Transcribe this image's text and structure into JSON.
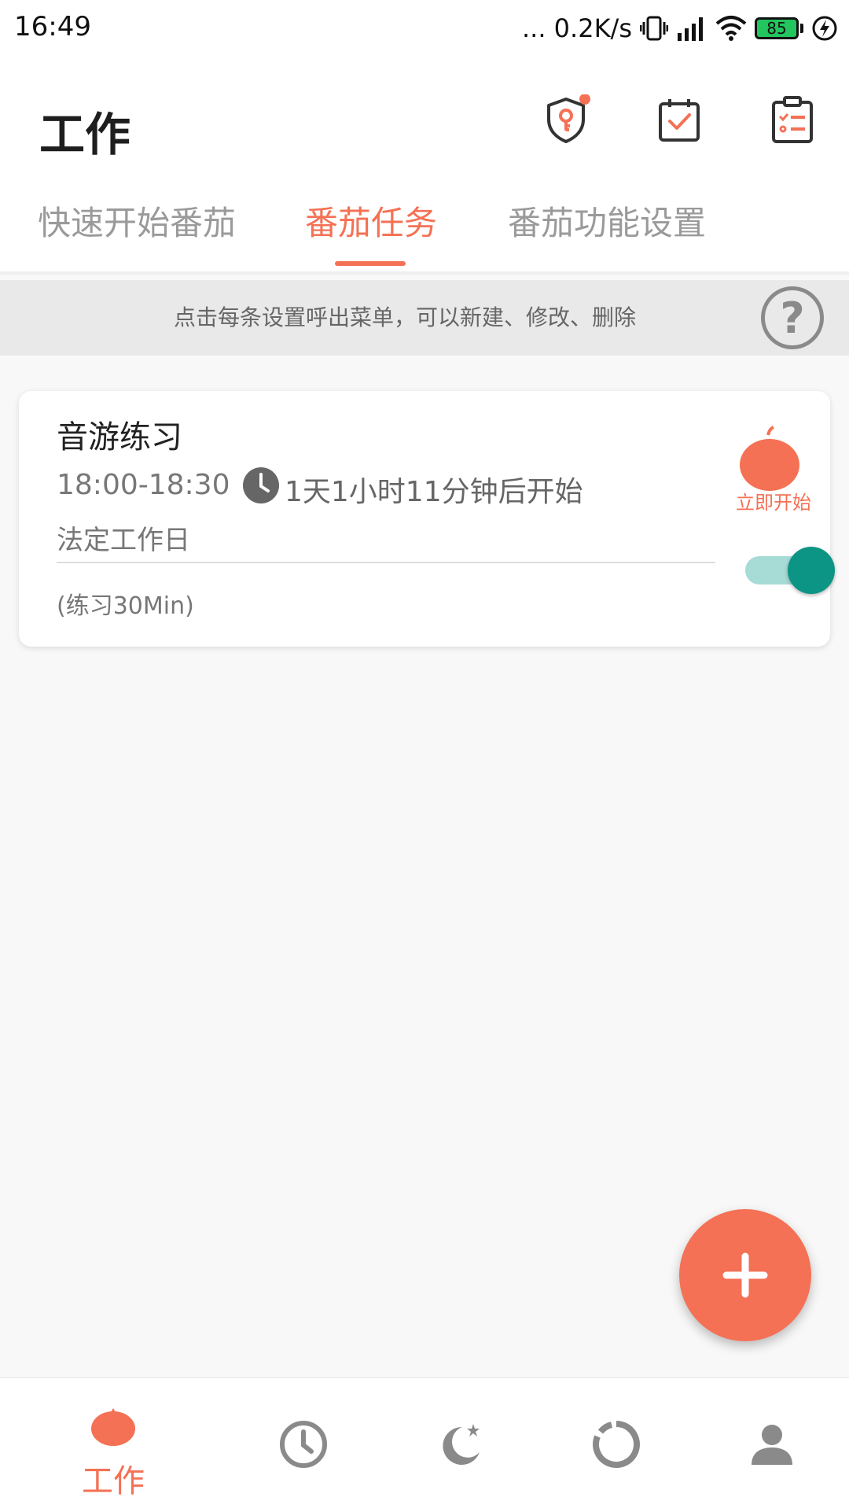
{
  "status_bar": {
    "time": "16:49",
    "network_speed": "... 0.2K/s",
    "battery": "85",
    "icons": [
      "vibrate-icon",
      "signal-icon",
      "wifi-icon",
      "battery-icon",
      "charging-icon"
    ]
  },
  "header": {
    "title": "工作",
    "icons": [
      "shield-key-icon",
      "calendar-check-icon",
      "clipboard-list-icon"
    ],
    "notification_dot_color": "#f47155"
  },
  "tabs": [
    {
      "label": "快速开始番茄",
      "active": false
    },
    {
      "label": "番茄任务",
      "active": true
    },
    {
      "label": "番茄功能设置",
      "active": false
    }
  ],
  "hint": {
    "text": "点击每条设置呼出菜单，可以新建、修改、删除",
    "help_symbol": "?"
  },
  "tasks": [
    {
      "name": "音游练习",
      "time_range": "18:00-18:30",
      "countdown": "1天1小时11分钟后开始",
      "days": "法定工作日",
      "note": "(练习30Min)",
      "start_label": "立即开始",
      "enabled": true
    }
  ],
  "fab": {
    "icon": "plus-icon"
  },
  "bottom_nav": [
    {
      "icon": "tomato-icon",
      "label": "工作",
      "active": true
    },
    {
      "icon": "clock-icon",
      "label": "",
      "active": false
    },
    {
      "icon": "moon-star-icon",
      "label": "",
      "active": false
    },
    {
      "icon": "ring-chart-icon",
      "label": "",
      "active": false
    },
    {
      "icon": "person-icon",
      "label": "",
      "active": false
    }
  ],
  "colors": {
    "accent": "#f47155",
    "toggle_on": "#0c9484",
    "toggle_track": "#a7dbd5",
    "inactive_icon": "#8a8a8a"
  }
}
